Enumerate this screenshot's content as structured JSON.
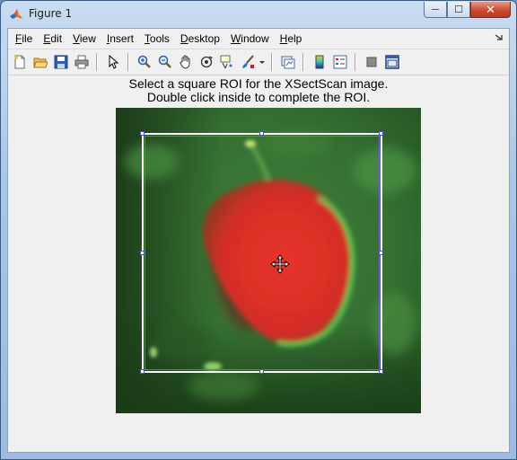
{
  "window": {
    "title": "Figure 1",
    "minimize_label": "─",
    "maximize_label": "☐",
    "close_label": "✕"
  },
  "menubar": {
    "items": [
      {
        "key": "file",
        "accel": "F",
        "rest": "ile"
      },
      {
        "key": "edit",
        "accel": "E",
        "rest": "dit"
      },
      {
        "key": "view",
        "accel": "V",
        "rest": "iew"
      },
      {
        "key": "insert",
        "accel": "I",
        "rest": "nsert"
      },
      {
        "key": "tools",
        "accel": "T",
        "rest": "ools"
      },
      {
        "key": "desktop",
        "accel": "D",
        "rest": "esktop"
      },
      {
        "key": "window",
        "accel": "W",
        "rest": "indow"
      },
      {
        "key": "help",
        "accel": "H",
        "rest": "elp"
      }
    ]
  },
  "toolbar": {
    "icons": [
      "new-figure-icon",
      "open-file-icon",
      "save-icon",
      "print-icon",
      "edit-plot-icon",
      "zoom-in-icon",
      "zoom-out-icon",
      "pan-icon",
      "rotate-3d-icon",
      "data-cursor-icon",
      "brush-icon",
      "link-plot-icon",
      "colorbar-icon",
      "legend-icon",
      "hide-plot-tools-icon",
      "show-plot-tools-icon"
    ]
  },
  "figure": {
    "title_line1": "Select a square ROI for the XSectScan image.",
    "title_line2": "Double click inside to complete the ROI."
  },
  "colors": {
    "background_green": "#2f6a2f",
    "cell_red": "#e0302a",
    "roi_outline": "#6a6ad8"
  }
}
